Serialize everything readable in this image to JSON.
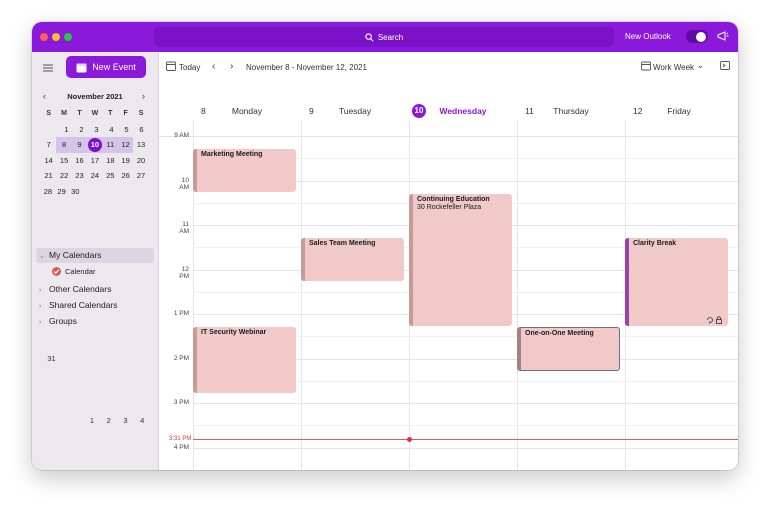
{
  "titlebar": {
    "search_label": "Search",
    "new_outlook_label": "New Outlook",
    "new_outlook_toggle_on": true
  },
  "sidebar": {
    "new_event_label": "New Event",
    "mini_calendar": {
      "month_label": "November 2021",
      "weekdays": [
        "S",
        "M",
        "T",
        "W",
        "T",
        "F",
        "S"
      ],
      "weeks": [
        [
          "31",
          "1",
          "2",
          "3",
          "4",
          "5",
          "6"
        ],
        [
          "7",
          "8",
          "9",
          "10",
          "11",
          "12",
          "13"
        ],
        [
          "14",
          "15",
          "16",
          "17",
          "18",
          "19",
          "20"
        ],
        [
          "21",
          "22",
          "23",
          "24",
          "25",
          "26",
          "27"
        ],
        [
          "28",
          "29",
          "30",
          "1",
          "2",
          "3",
          "4"
        ]
      ],
      "today": "10"
    },
    "my_calendars_label": "My Calendars",
    "calendar_item_label": "Calendar",
    "other_calendars_label": "Other Calendars",
    "shared_calendars_label": "Shared Calendars",
    "groups_label": "Groups"
  },
  "toolbar": {
    "today_label": "Today",
    "date_range": "November 8 - November 12, 2021",
    "view_label": "Work Week"
  },
  "days": [
    {
      "num": "8",
      "name": "Monday"
    },
    {
      "num": "9",
      "name": "Tuesday"
    },
    {
      "num": "10",
      "name": "Wednesday"
    },
    {
      "num": "11",
      "name": "Thursday"
    },
    {
      "num": "12",
      "name": "Friday"
    }
  ],
  "hours": [
    "9 AM",
    "10 AM",
    "11 AM",
    "12 PM",
    "1 PM",
    "2 PM",
    "3 PM",
    "4 PM"
  ],
  "current_time": "3:31 PM",
  "events": [
    {
      "title": "Marketing Meeting",
      "location": ""
    },
    {
      "title": "Continuing Education",
      "location": "30 Rockefeller Plaza"
    },
    {
      "title": "Sales Team Meeting",
      "location": ""
    },
    {
      "title": "Clarity Break",
      "location": ""
    },
    {
      "title": "IT Security Webinar",
      "location": ""
    },
    {
      "title": "One-on-One Meeting",
      "location": ""
    }
  ],
  "colors": {
    "accent": "#8a19d9",
    "event_fill": "#f1c9c9",
    "now_line": "#e05a5a"
  }
}
